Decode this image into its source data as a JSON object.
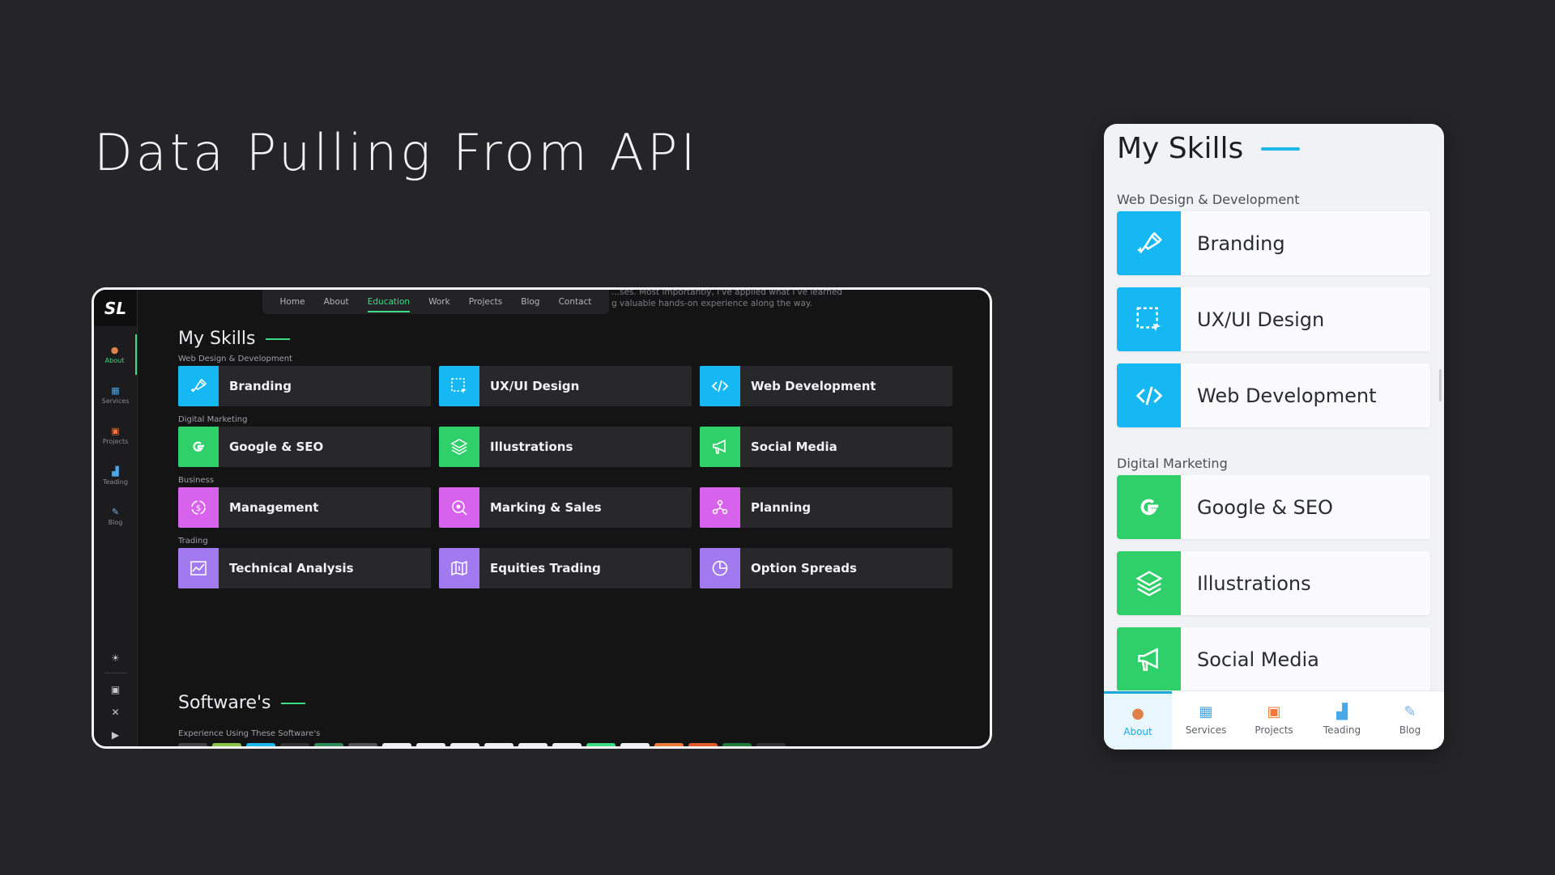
{
  "headline": "Data Pulling From API",
  "colors": {
    "blue": "#16b8f3",
    "green": "#2fd06a",
    "pink": "#d763ec",
    "purple": "#a27af0",
    "accent_green": "#3ddc84",
    "accent_blue": "#1db8e8"
  },
  "desktop": {
    "logo": "SL",
    "sidebar": [
      {
        "label": "About",
        "icon": "person-icon"
      },
      {
        "label": "Services",
        "icon": "services-icon"
      },
      {
        "label": "Projects",
        "icon": "projects-icon"
      },
      {
        "label": "Teading",
        "icon": "chart-icon"
      },
      {
        "label": "Blog",
        "icon": "blog-icon"
      }
    ],
    "topnav": [
      "Home",
      "About",
      "Education",
      "Work",
      "Projects",
      "Blog",
      "Contact"
    ],
    "intro_line1": "...ses. Most importantly, I've applied what I've learned",
    "intro_line2": "g valuable hands-on experience along the way.",
    "skills_title": "My Skills",
    "categories": [
      {
        "name": "Web Design & Development",
        "items": [
          "Branding",
          "UX/UI Design",
          "Web Development"
        ]
      },
      {
        "name": "Digital Marketing",
        "items": [
          "Google & SEO",
          "Illustrations",
          "Social Media"
        ]
      },
      {
        "name": "Business",
        "items": [
          "Management",
          "Marking & Sales",
          "Planning"
        ]
      },
      {
        "name": "Trading",
        "items": [
          "Technical Analysis",
          "Equities Trading",
          "Option Spreads"
        ]
      }
    ],
    "software_title": "Software's",
    "software_sub": "Experience Using These Software's"
  },
  "mobile": {
    "title": "My Skills",
    "categories": [
      {
        "name": "Web Design & Development",
        "items": [
          "Branding",
          "UX/UI Design",
          "Web Development"
        ]
      },
      {
        "name": "Digital Marketing",
        "items": [
          "Google & SEO",
          "Illustrations",
          "Social Media"
        ]
      }
    ],
    "nav": [
      "About",
      "Services",
      "Projects",
      "Teading",
      "Blog"
    ]
  }
}
